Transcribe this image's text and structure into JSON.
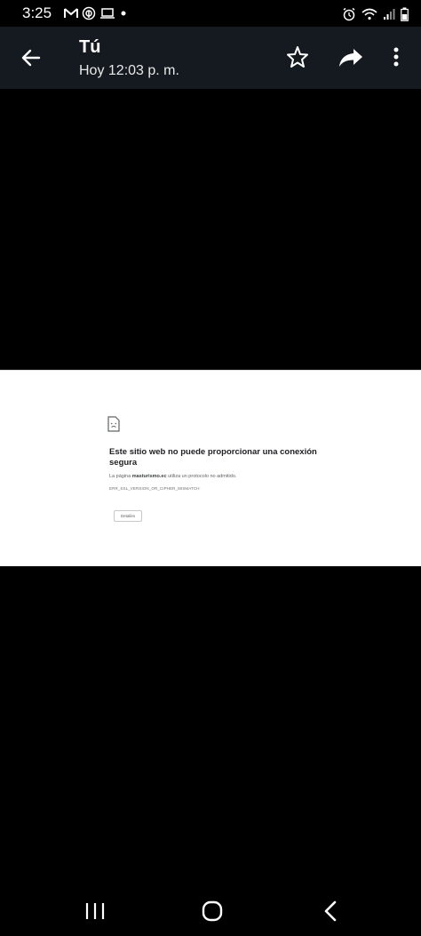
{
  "status_bar": {
    "time": "3:25",
    "left_icons": [
      "gmail-icon",
      "vpn-icon",
      "laptop-icon",
      "dot-icon"
    ],
    "right_icons": [
      "alarm-icon",
      "wifi-icon",
      "signal-icon",
      "battery-icon"
    ]
  },
  "header": {
    "title": "Tú",
    "subtitle": "Hoy 12:03 p. m.",
    "icons": [
      "back-arrow-icon",
      "star-icon",
      "share-icon",
      "more-vert-icon"
    ]
  },
  "image_content": {
    "error_title": "Este sitio web no puede proporcionar una conexión segura",
    "description_prefix": "La página",
    "description_domain": "masturismo.ec",
    "description_suffix": "utiliza un protocolo no admitido.",
    "error_code": "ERR_SSL_VERSION_OR_CIPHER_MISMATCH",
    "details_button": "Detalles"
  },
  "nav_bar": {
    "icons": [
      "recents-icon",
      "home-icon",
      "back-icon"
    ]
  },
  "colors": {
    "header_bg": "#141a20",
    "viewer_bg": "#000000",
    "page_bg": "#ffffff"
  }
}
